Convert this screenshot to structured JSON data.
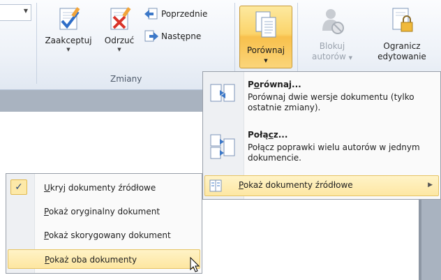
{
  "ribbon": {
    "zaakceptuj": "Zaakceptuj",
    "odrzuc": "Odrzuć",
    "poprzednie": "Poprzednie",
    "nastepne": "Następne",
    "group_zmiany": "Zmiany",
    "porownaj": "Porównaj",
    "blokuj_line1": "Blokuj",
    "blokuj_line2": "autorów",
    "ogranicz_line1": "Ogranicz",
    "ogranicz_line2": "edytowanie"
  },
  "menu": {
    "compare": {
      "title_pre": "P",
      "title_ul": "o",
      "title_post": "równaj...",
      "desc": "Porównaj dwie wersje dokumentu (tylko ostatnie zmiany)."
    },
    "combine": {
      "title_pre": "Połą",
      "title_ul": "c",
      "title_post": "z...",
      "desc": "Połącz poprawki wielu autorów w jednym dokumencie."
    },
    "show_sources": {
      "label_ul": "P",
      "label_post": "okaż dokumenty źródłowe"
    }
  },
  "submenu": {
    "hide": {
      "ul": "U",
      "post": "kryj dokumenty źródłowe",
      "checked": true
    },
    "original": {
      "ul": "P",
      "post": "okaż oryginalny dokument"
    },
    "revised": {
      "ul": "P",
      "post": "okaż skorygowany dokument"
    },
    "both": {
      "ul": "P",
      "post": "okaż oba dokumenty"
    }
  },
  "colors": {
    "highlight": "#fde7a3",
    "highlight_border": "#e5c365",
    "ribbon_bg": "#eef2f8"
  }
}
